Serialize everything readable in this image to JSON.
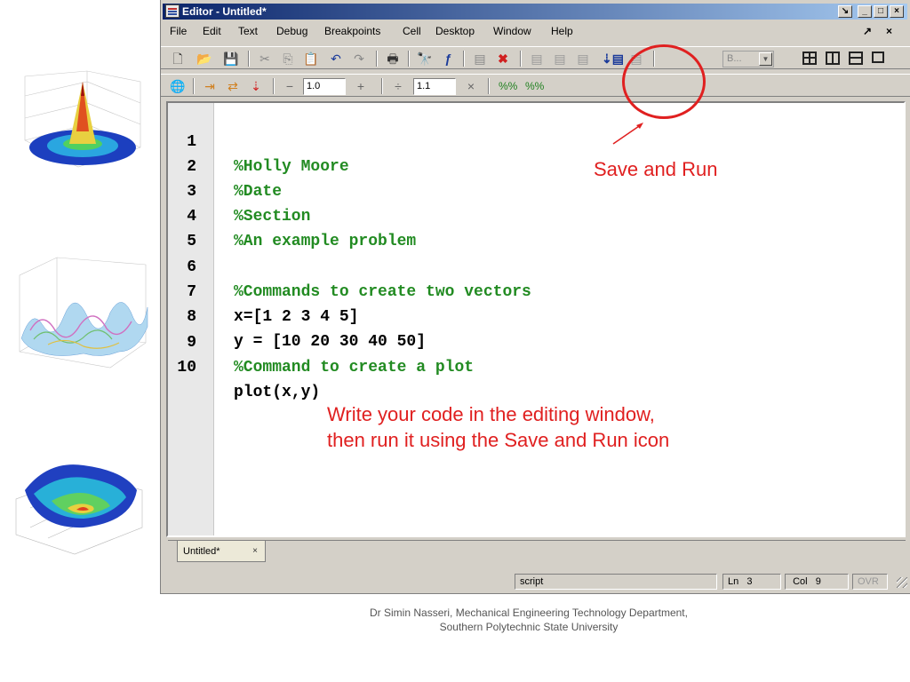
{
  "window": {
    "title": "Editor - Untitled*",
    "min_btn": "_",
    "max_btn": "□",
    "close_btn": "×",
    "undock_btn": "↘"
  },
  "menu": {
    "items": [
      "File",
      "Edit",
      "Text",
      "Debug",
      "Breakpoints",
      "Cell",
      "Desktop",
      "Window",
      "Help"
    ],
    "dock_glyph": "↗",
    "close_glyph": "×"
  },
  "toolbar1": {
    "icons": [
      "new-file-icon",
      "open-folder-icon",
      "save-icon",
      "cut-icon",
      "copy-icon",
      "paste-icon",
      "undo-icon",
      "redo-icon",
      "print-icon",
      "find-icon",
      "function-icon",
      "set-breakpoint-icon",
      "clear-breakpoint-icon",
      "step-icon",
      "step-in-icon",
      "step-out-icon",
      "save-and-run-icon",
      "exit-debug-icon",
      "layout-icons"
    ],
    "stack_value": "B...",
    "cell_value_1": "1.0",
    "cell_value_2": "1.1"
  },
  "code_lines": [
    {
      "num": "1",
      "text": "%Holly Moore",
      "type": "comment"
    },
    {
      "num": "2",
      "text": "%Date",
      "type": "comment"
    },
    {
      "num": "3",
      "text": "%Section",
      "type": "comment"
    },
    {
      "num": "4",
      "text": "%An example problem",
      "type": "comment"
    },
    {
      "num": "5",
      "text": "",
      "type": "normal"
    },
    {
      "num": "6",
      "text": "%Commands to create two vectors",
      "type": "comment"
    },
    {
      "num": "7",
      "text": "x=[1 2 3 4 5]",
      "type": "normal"
    },
    {
      "num": "8",
      "text": "y = [10 20 30 40 50]",
      "type": "normal"
    },
    {
      "num": "9",
      "text": "%Command to create a plot",
      "type": "comment"
    },
    {
      "num": "10",
      "text": "plot(x,y)",
      "type": "normal"
    }
  ],
  "doc_tab": {
    "label": "Untitled*",
    "close": "×"
  },
  "status": {
    "mode": "script",
    "ln_label": "Ln",
    "ln_value": "3",
    "col_label": "Col",
    "col_value": "9",
    "ovr": "OVR"
  },
  "annotations": {
    "save_and_run": "Save and Run",
    "write_line1": "Write your code in the editing window,",
    "write_line2": "then run it using the Save and Run icon"
  },
  "footer": {
    "line1": "Dr Simin Nasseri, Mechanical Engineering Technology Department,",
    "line2": "Southern Polytechnic State University"
  },
  "colors": {
    "comment": "#228b22",
    "annotation": "#e02020",
    "title_bar": "#0a246a"
  }
}
